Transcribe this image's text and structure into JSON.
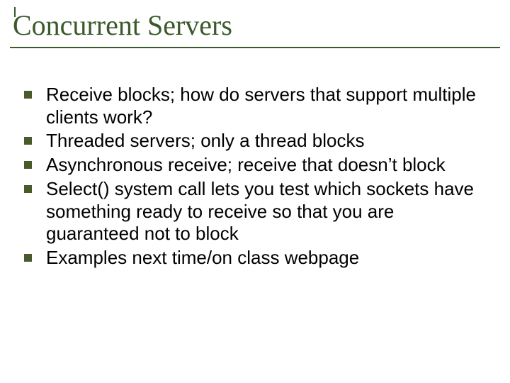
{
  "title": "Concurrent Servers",
  "bullets": [
    "Receive blocks; how do servers that support multiple clients work?",
    "Threaded servers; only a thread blocks",
    "Asynchronous receive; receive that doesn’t block",
    "Select() system call lets you test which sockets have something ready to receive so that you are guaranteed not to block",
    "Examples next time/on class webpage"
  ],
  "colors": {
    "title": "#3a5a2a",
    "bullet": "#4a5a2a",
    "text": "#000000",
    "background": "#ffffff"
  }
}
